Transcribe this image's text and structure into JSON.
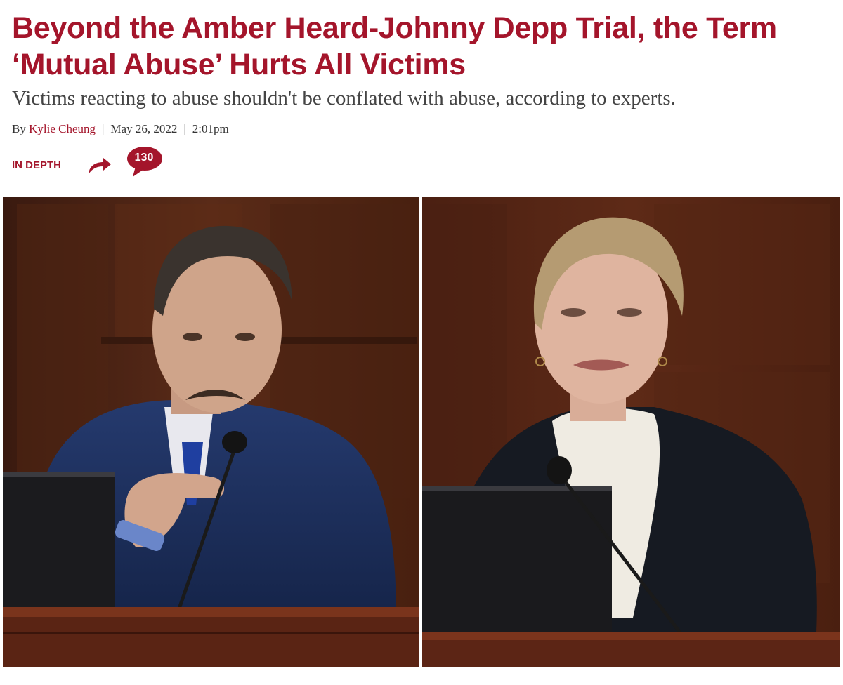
{
  "article": {
    "headline": "Beyond the Amber Heard-Johnny Depp Trial, the Term ‘Mutual Abuse’ Hurts All Victims",
    "dek": "Victims reacting to abuse shouldn't be conflated with abuse, according to experts.",
    "byline": {
      "prefix": "By",
      "author": "Kylie Cheung",
      "separator": "|",
      "date": "May 26, 2022",
      "time": "2:01pm"
    },
    "tag": "IN DEPTH",
    "comment_count": "130",
    "icons": {
      "share": "share-arrow-icon",
      "comments": "speech-bubble-icon"
    },
    "colors": {
      "accent": "#a4152b",
      "dek": "#444444",
      "byline": "#333333"
    }
  }
}
